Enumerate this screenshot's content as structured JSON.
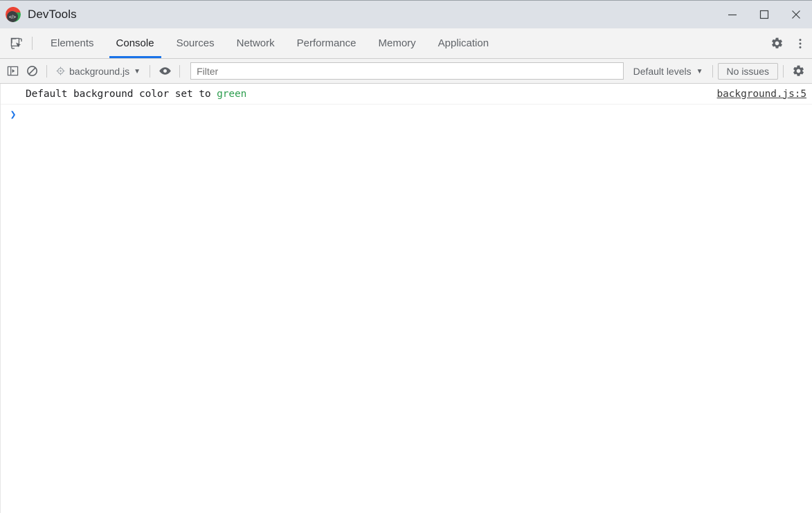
{
  "window": {
    "title": "DevTools",
    "app_icon": "chrome-devtools-icon",
    "controls": {
      "minimize_label": "Minimize",
      "maximize_label": "Maximize",
      "close_label": "Close"
    }
  },
  "tabbar": {
    "inspect_icon": "inspect-element-icon",
    "tabs": [
      {
        "label": "Elements",
        "active": false
      },
      {
        "label": "Console",
        "active": true
      },
      {
        "label": "Sources",
        "active": false
      },
      {
        "label": "Network",
        "active": false
      },
      {
        "label": "Performance",
        "active": false
      },
      {
        "label": "Memory",
        "active": false
      },
      {
        "label": "Application",
        "active": false
      }
    ],
    "settings_icon": "gear-icon",
    "more_icon": "more-vertical-icon"
  },
  "console_toolbar": {
    "sidebar_toggle_icon": "console-sidebar-icon",
    "clear_icon": "clear-console-icon",
    "context": {
      "icon": "target-context-icon",
      "label": "background.js",
      "caret": "▼"
    },
    "eye_icon": "eye-icon",
    "filter": {
      "value": "",
      "placeholder": "Filter"
    },
    "levels": {
      "label": "Default levels",
      "caret": "▼"
    },
    "issues_label": "No issues",
    "settings_icon": "gear-icon"
  },
  "console": {
    "messages": [
      {
        "text_before": "Default background color set to ",
        "highlight": "green",
        "highlight_color": "#2e9e4f",
        "source": "background.js:5"
      }
    ],
    "prompt": {
      "arrow": "❯",
      "value": ""
    }
  },
  "colors": {
    "titlebar_bg": "#dde1e7",
    "toolbar_bg": "#f3f3f3",
    "accent": "#1a73e8",
    "text": "#202124",
    "muted_text": "#5f6368",
    "console_bg": "#ffffff"
  }
}
